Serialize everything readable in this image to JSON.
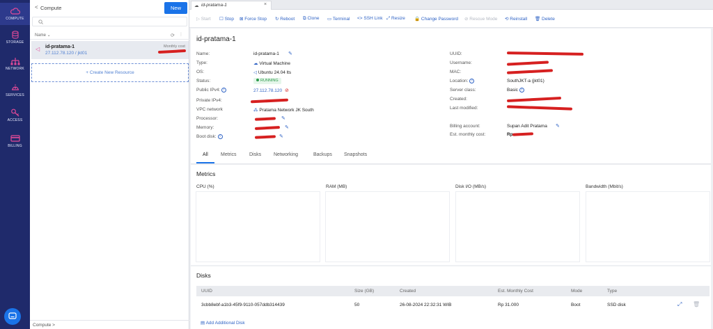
{
  "nav": {
    "items": [
      {
        "label": "COMPUTE",
        "icon": "cloud-icon"
      },
      {
        "label": "STORAGE",
        "icon": "database-icon"
      },
      {
        "label": "NETWORK",
        "icon": "network-icon"
      },
      {
        "label": "SERVICES",
        "icon": "services-icon"
      },
      {
        "label": "ACCESS",
        "icon": "key-icon"
      },
      {
        "label": "BILLING",
        "icon": "credit-card-icon"
      }
    ]
  },
  "panel": {
    "back": "<",
    "title": "Compute",
    "new_label": "New",
    "search_placeholder": "",
    "column_name": "Name ⌄",
    "resource": {
      "name": "id-pratama-1",
      "sub": "27.112.78.120 / jkt01",
      "cost_label": "Monthly cost"
    },
    "create_label": "+ Create New Resource",
    "footer": "Compute  >"
  },
  "tab": {
    "title": "id-pratama-1",
    "close": "×"
  },
  "toolbar": {
    "start": "▷ Start",
    "stop": "☐ Stop",
    "force_stop": "⊠ Force Stop",
    "reboot": "↻ Reboot",
    "clone": "⧉ Clone",
    "terminal": "▭ Terminal",
    "ssh": "<> SSH Link",
    "resize": "⤢ Resize",
    "password": "🔒 Change Password",
    "rescue": "⊘ Rescue Mode",
    "reinstall": "⟲ Reinstall",
    "delete": "🗑 Delete"
  },
  "detail": {
    "title": "id-pratama-1",
    "left": {
      "name_label": "Name:",
      "name": "id-pratama-1",
      "type_label": "Type:",
      "type": "Virtual Machine",
      "os_label": "OS:",
      "os": "Ubuntu 24.04 lts",
      "status_label": "Status:",
      "status": "RUNNING",
      "ipv4_label": "Public IPv4:",
      "ipv4": "27.112.78.120",
      "private_label": "Private IPv4:",
      "vpc_label": "VPC network",
      "vpc": "Pratama Network JK South",
      "processor_label": "Processor:",
      "memory_label": "Memory:",
      "boot_label": "Boot disk:"
    },
    "right": {
      "uuid_label": "UUID:",
      "username_label": "Username:",
      "mac_label": "MAC:",
      "location_label": "Location:",
      "location": "SouthJKT-a (jkt01)",
      "class_label": "Server class:",
      "class": "Basic",
      "created_label": "Created:",
      "modified_label": "Last modified:",
      "billing_label": "Billing account:",
      "billing": "Supan Adit Pratama",
      "cost_label": "Est. monthly cost:",
      "cost": "Rp"
    }
  },
  "detail_tabs": [
    "All",
    "Metrics",
    "Disks",
    "Networking",
    "Backups",
    "Snapshots"
  ],
  "metrics": {
    "title": "Metrics",
    "charts": [
      "CPU (%)",
      "RAM (MB)",
      "Disk I/O (MB/s)",
      "Bandwidth (Mbit/s)"
    ]
  },
  "disks": {
    "title": "Disks",
    "headers": [
      "UUID",
      "Size (GB)",
      "Created",
      "Est. Monthly Cost",
      "Mode",
      "Type"
    ],
    "row": [
      "3cbb8ebf-a1b3-45f9-9110-057ddb314439",
      "50",
      "26-08-2024 22:32:31 WIB",
      "Rp 31.000",
      "Boot",
      "SSD disk"
    ],
    "add_label": "Add Additional Disk"
  },
  "colors": {
    "nav_bg": "#1f2a6b",
    "accent": "#1a73e8",
    "nav_icon": "#e24a98",
    "redaction": "#d62020"
  }
}
